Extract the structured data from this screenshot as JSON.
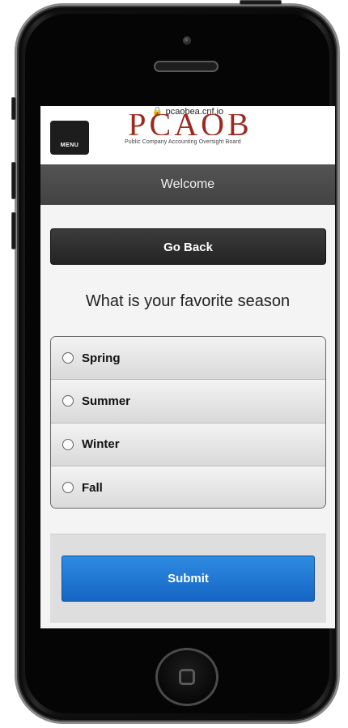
{
  "url": "pcaobea.cnf.io",
  "header": {
    "menu_label": "MENU",
    "logo_text": "PCAOB",
    "tagline": "Public Company Accounting Oversight Board"
  },
  "page_title": "Welcome",
  "go_back_label": "Go Back",
  "question": "What is your favorite season",
  "options": [
    {
      "label": "Spring",
      "selected": false
    },
    {
      "label": "Summer",
      "selected": false
    },
    {
      "label": "Winter",
      "selected": false
    },
    {
      "label": "Fall",
      "selected": false
    }
  ],
  "submit_label": "Submit",
  "colors": {
    "accent_blue": "#1b74d2",
    "title_bar": "#4a4a4a",
    "logo_red": "#9b2a1f"
  }
}
